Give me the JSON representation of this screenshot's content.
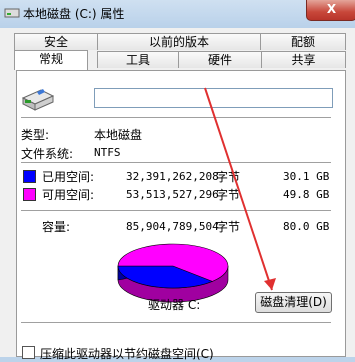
{
  "window": {
    "title": "本地磁盘 (C:) 属性",
    "close_glyph": "X"
  },
  "tabs": {
    "row1": [
      "安全",
      "以前的版本",
      "配额"
    ],
    "row2": [
      "常规",
      "工具",
      "硬件",
      "共享"
    ],
    "active": "常规"
  },
  "general": {
    "name_value": "",
    "type_label": "类型:",
    "type_value": "本地磁盘",
    "fs_label": "文件系统:",
    "fs_value": "NTFS",
    "used_label": "已用空间:",
    "used_bytes": "32,391,262,208",
    "used_unit": "字节",
    "used_size": "30.1 GB",
    "free_label": "可用空间:",
    "free_bytes": "53,513,527,296",
    "free_unit": "字节",
    "free_size": "49.8 GB",
    "capacity_label": "容量:",
    "capacity_bytes": "85,904,789,504",
    "capacity_unit": "字节",
    "capacity_size": "80.0 GB",
    "drive_label": "驱动器 C:",
    "cleanup_button": "磁盘清理(D)",
    "compress_label": "压缩此驱动器以节约磁盘空间(C)"
  },
  "colors": {
    "used": "#0000ff",
    "free": "#ff00ff",
    "arrow": "#e03030"
  },
  "chart_data": {
    "type": "pie",
    "categories": [
      "已用空间",
      "可用空间"
    ],
    "values": [
      32391262208,
      53513527296
    ]
  }
}
